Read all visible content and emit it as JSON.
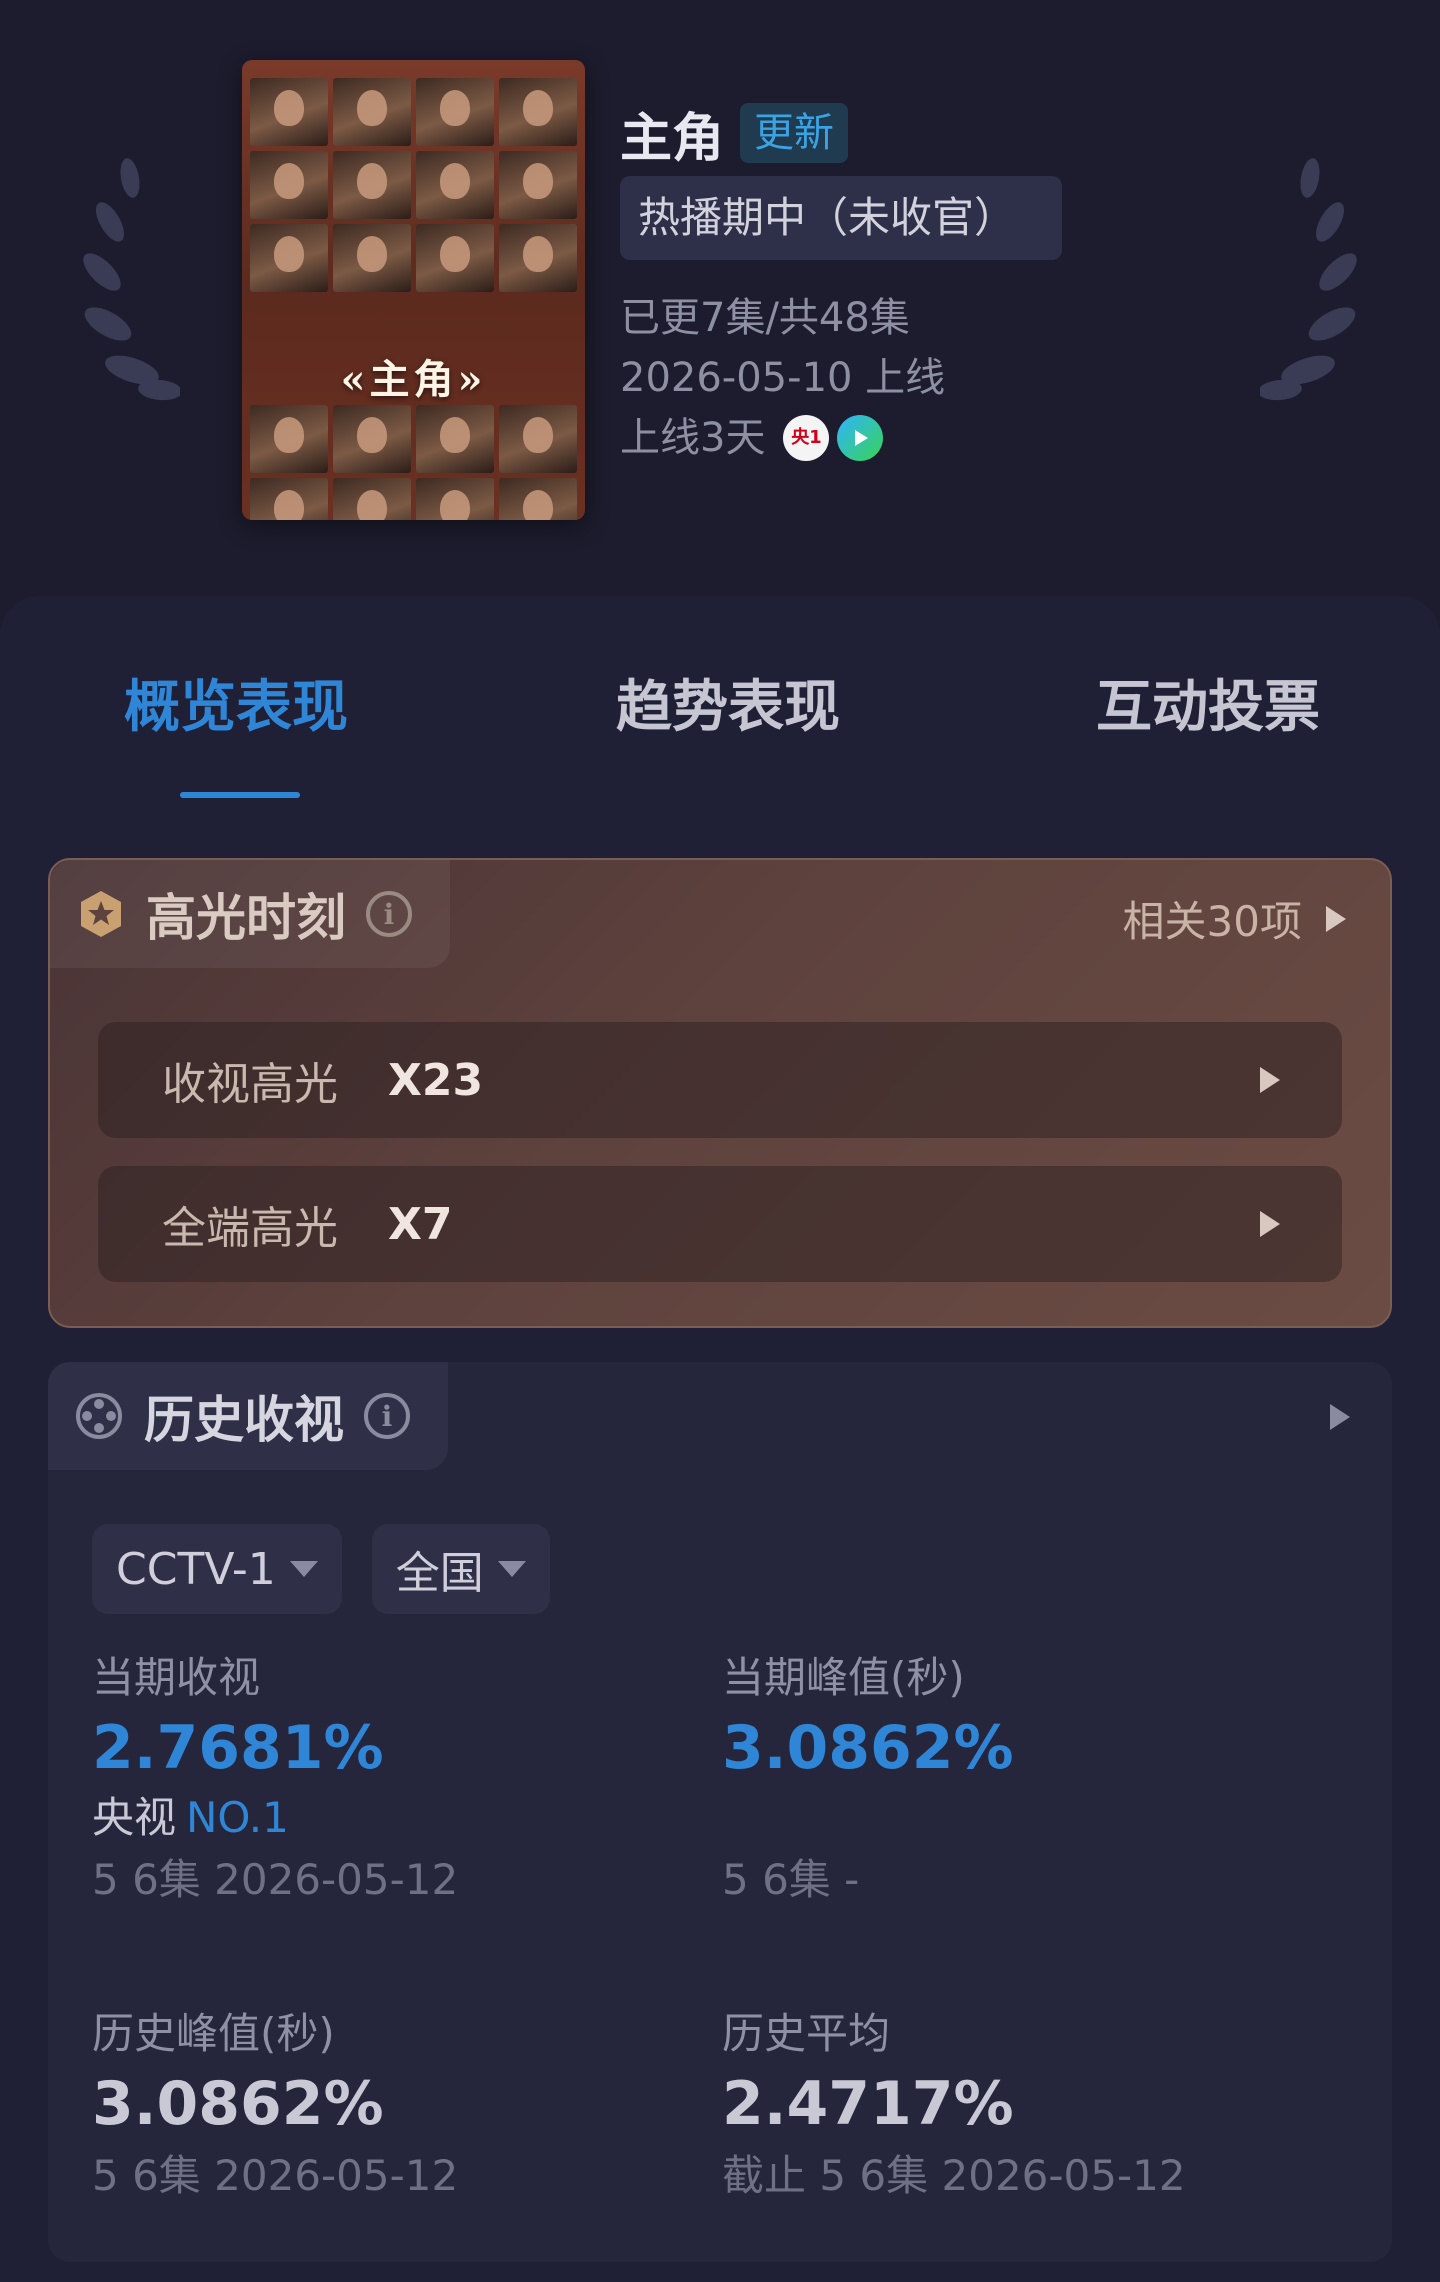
{
  "show": {
    "title": "主角",
    "update_badge": "更新",
    "status": "热播期中（未收官）",
    "episodes": "已更7集/共48集",
    "release": "2026-05-10 上线",
    "days_online": "上线3天",
    "platforms": [
      {
        "name": "央1",
        "icon": "cctv1-icon"
      },
      {
        "name": "",
        "icon": "iqiyi-play-icon"
      }
    ],
    "poster_title": "«主角»"
  },
  "tabs": [
    {
      "label": "概览表现",
      "active": true
    },
    {
      "label": "趋势表现",
      "active": false
    },
    {
      "label": "互动投票",
      "active": false
    }
  ],
  "highlights": {
    "title": "高光时刻",
    "related": "相关30项",
    "rows": [
      {
        "label": "收视高光",
        "value": "X23"
      },
      {
        "label": "全端高光",
        "value": "X7"
      }
    ]
  },
  "history": {
    "title": "历史收视",
    "channel": "CCTV-1",
    "region": "全国",
    "current": {
      "label": "当期收视",
      "value": "2.7681%",
      "rank_prefix": "央视",
      "rank": "NO.1",
      "sub": "5 6集  2026-05-12"
    },
    "current_peak": {
      "label": "当期峰值(秒)",
      "value": "3.0862%",
      "sub": "5 6集  -"
    },
    "history_peak": {
      "label": "历史峰值(秒)",
      "value": "3.0862%",
      "sub": "5 6集  2026-05-12"
    },
    "history_avg": {
      "label": "历史平均",
      "value": "2.4717%",
      "sub": "截止 5 6集  2026-05-12"
    }
  },
  "colors": {
    "accent": "#2f86d6",
    "background": "#1c1c2e",
    "highlight_card": "#5e423d"
  }
}
